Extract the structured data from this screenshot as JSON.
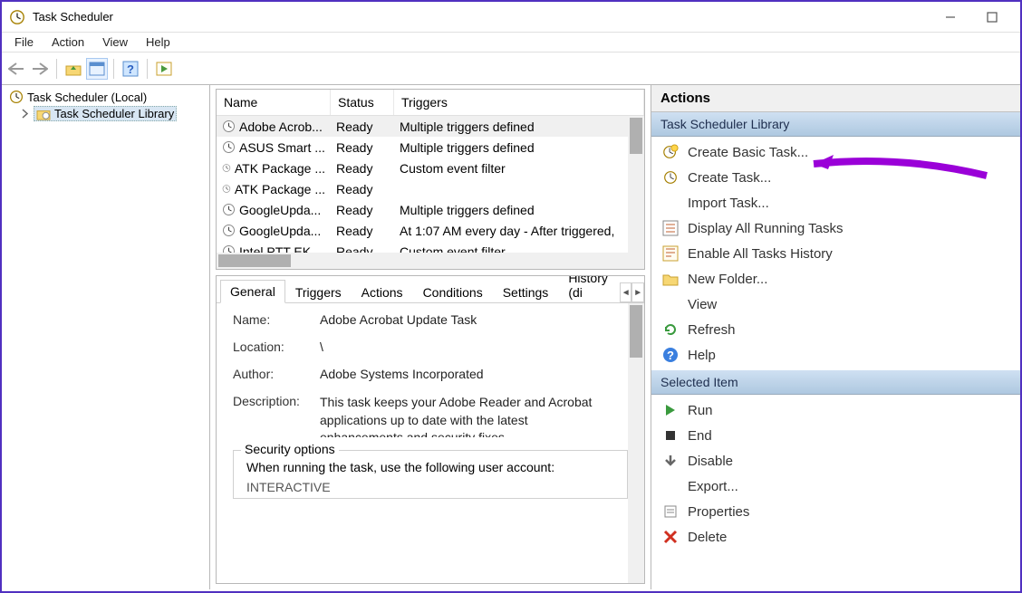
{
  "window": {
    "title": "Task Scheduler"
  },
  "menu": {
    "file": "File",
    "action": "Action",
    "view": "View",
    "help": "Help"
  },
  "tree": {
    "root": "Task Scheduler (Local)",
    "library": "Task Scheduler Library"
  },
  "task_columns": {
    "name": "Name",
    "status": "Status",
    "triggers": "Triggers"
  },
  "tasks": [
    {
      "name": "Adobe Acrob...",
      "status": "Ready",
      "triggers": "Multiple triggers defined"
    },
    {
      "name": "ASUS Smart ...",
      "status": "Ready",
      "triggers": "Multiple triggers defined"
    },
    {
      "name": "ATK Package ...",
      "status": "Ready",
      "triggers": "Custom event filter"
    },
    {
      "name": "ATK Package ...",
      "status": "Ready",
      "triggers": ""
    },
    {
      "name": "GoogleUpda...",
      "status": "Ready",
      "triggers": "Multiple triggers defined"
    },
    {
      "name": "GoogleUpda...",
      "status": "Ready",
      "triggers": "At 1:07 AM every day - After triggered,"
    },
    {
      "name": "Intel PTT EK",
      "status": "Ready",
      "triggers": "Custom event filter"
    }
  ],
  "tabs": {
    "general": "General",
    "triggers": "Triggers",
    "actions": "Actions",
    "conditions": "Conditions",
    "settings": "Settings",
    "history": "History (di"
  },
  "details": {
    "labels": {
      "name": "Name:",
      "location": "Location:",
      "author": "Author:",
      "description": "Description:"
    },
    "name": "Adobe Acrobat Update Task",
    "location": "\\",
    "author": "Adobe Systems Incorporated",
    "description": "This task keeps your Adobe Reader and Acrobat applications up to date with the latest enhancements and security fixes",
    "security_legend": "Security options",
    "security_line1": "When running the task, use the following user account:",
    "security_line2": "INTERACTIVE"
  },
  "actions_pane": {
    "header": "Actions",
    "group1": "Task Scheduler Library",
    "items1": [
      {
        "id": "create-basic",
        "label": "Create Basic Task...",
        "icon": "clock-new"
      },
      {
        "id": "create-task",
        "label": "Create Task...",
        "icon": "clock-new2"
      },
      {
        "id": "import-task",
        "label": "Import Task...",
        "icon": "blank"
      },
      {
        "id": "display-running",
        "label": "Display All Running Tasks",
        "icon": "list"
      },
      {
        "id": "enable-history",
        "label": "Enable All Tasks History",
        "icon": "enable"
      },
      {
        "id": "new-folder",
        "label": "New Folder...",
        "icon": "folder"
      },
      {
        "id": "view",
        "label": "View",
        "icon": "blank"
      },
      {
        "id": "refresh",
        "label": "Refresh",
        "icon": "refresh"
      },
      {
        "id": "help",
        "label": "Help",
        "icon": "help"
      }
    ],
    "group2": "Selected Item",
    "items2": [
      {
        "id": "run",
        "label": "Run",
        "icon": "run"
      },
      {
        "id": "end",
        "label": "End",
        "icon": "end"
      },
      {
        "id": "disable",
        "label": "Disable",
        "icon": "disable"
      },
      {
        "id": "export",
        "label": "Export...",
        "icon": "blank"
      },
      {
        "id": "properties",
        "label": "Properties",
        "icon": "props"
      },
      {
        "id": "delete",
        "label": "Delete",
        "icon": "delete"
      }
    ]
  }
}
